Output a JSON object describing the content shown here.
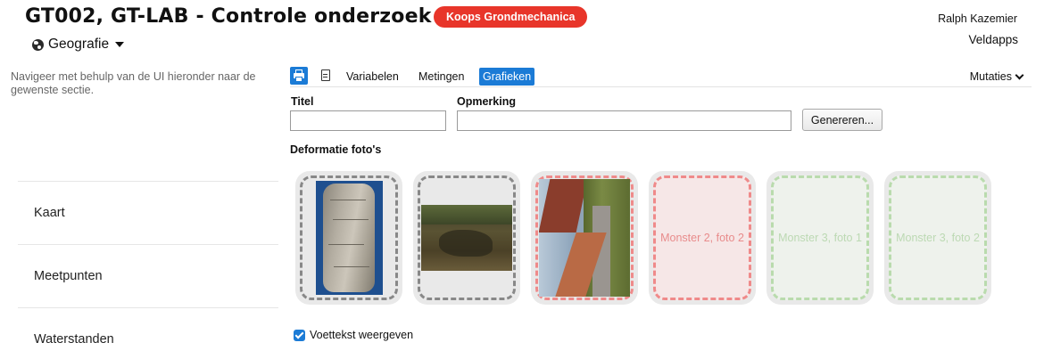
{
  "header": {
    "title": "GT002, GT-LAB - Controle onderzoek",
    "company_badge": "Koops Grondmechanica",
    "user_name": "Ralph Kazemier",
    "org_name": "Veldapps",
    "project_dropdown": {
      "icon": "globe-icon",
      "label": "Geografie"
    }
  },
  "sidebar": {
    "hint": "Navigeer met behulp van de UI hieronder naar de gewenste sectie.",
    "items": [
      {
        "label": "Kaart"
      },
      {
        "label": "Meetpunten"
      },
      {
        "label": "Waterstanden"
      }
    ]
  },
  "toolbar": {
    "print_icon": "print-icon",
    "document_icon": "document-icon",
    "tabs": [
      {
        "label": "Variabelen",
        "active": false
      },
      {
        "label": "Metingen",
        "active": false
      },
      {
        "label": "Grafieken",
        "active": true
      }
    ],
    "mutaties_label": "Mutaties",
    "accent_color": "#1b7bd6"
  },
  "form": {
    "titel_label": "Titel",
    "titel_value": "",
    "opmerking_label": "Opmerking",
    "opmerking_value": "",
    "generate_label": "Genereren..."
  },
  "photos": {
    "section_title": "Deformatie foto's",
    "tiles": [
      {
        "state": "filled",
        "color": "grey",
        "label": ""
      },
      {
        "state": "filled",
        "color": "grey",
        "label": ""
      },
      {
        "state": "filled",
        "color": "red",
        "label": ""
      },
      {
        "state": "empty",
        "color": "red",
        "label": "Monster 2, foto 2"
      },
      {
        "state": "empty",
        "color": "green",
        "label": "Monster 3, foto 1"
      },
      {
        "state": "empty",
        "color": "green",
        "label": "Monster 3, foto 2"
      }
    ]
  },
  "footer": {
    "checkbox_label": "Voettekst weergeven",
    "checked": true
  },
  "colors": {
    "badge": "#e8352a",
    "red_dash": "#ef8a8a",
    "green_dash": "#b9dbad",
    "grey_dash": "#888888"
  }
}
